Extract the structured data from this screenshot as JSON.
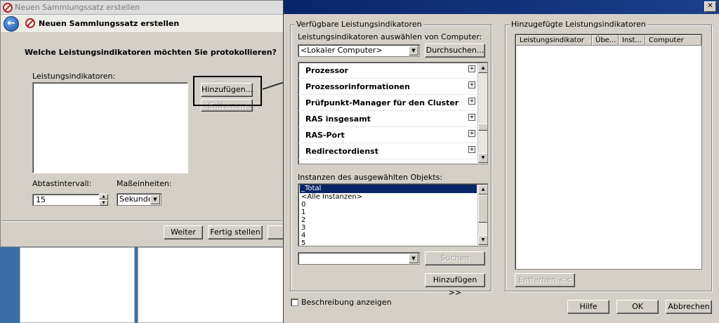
{
  "wizard": {
    "window_title": "Neuen Sammlungssatz erstellen",
    "header_title": "Neuen Sammlungssatz erstellen",
    "question": "Welche Leistungsindikatoren möchten Sie protokollieren?",
    "counters_label": "Leistungsindikatoren:",
    "add_button": "Hinzufügen...",
    "remove_button": "Entfernen",
    "interval_label": "Abtastintervall:",
    "interval_value": "15",
    "units_label": "Maßeinheiten:",
    "units_value": "Sekunden",
    "next_button": "Weiter",
    "finish_button": "Fertig stellen"
  },
  "dialog": {
    "available_group": "Verfügbare Leistungsindikatoren",
    "select_from_label": "Leistungsindikatoren auswählen von Computer:",
    "computer_value": "<Lokaler Computer>",
    "browse_button": "Durchsuchen...",
    "objects": [
      "Prozessor",
      "Prozessorinformationen",
      "Prüfpunkt-Manager für den Cluster",
      "RAS insgesamt",
      "RAS-Port",
      "Redirectordienst"
    ],
    "instances_label": "Instanzen des ausgewählten Objekts:",
    "instances": [
      "_Total",
      "<Alle Instanzen>",
      "0",
      "1",
      "2",
      "3",
      "4",
      "5"
    ],
    "selected_instance": "_Total",
    "search_button": "Suchen",
    "add_button": "Hinzufügen >>",
    "added_group": "Hinzugefügte Leistungsindikatoren",
    "table_headers": [
      "Leistungsindikator",
      "Übe...",
      "Inst...",
      "Computer"
    ],
    "remove_button": "Entfernen <<",
    "show_description_label": "Beschreibung anzeigen",
    "show_description_checked": false,
    "help_button": "Hilfe",
    "ok_button": "OK",
    "cancel_button": "Abbrechen"
  },
  "colors": {
    "desktop": "#3a6ea5",
    "titlebar_active": "#0a246a",
    "selection": "#0a246a",
    "window_face": "#d4d0c8"
  },
  "icons": {
    "back": "back-arrow-icon",
    "app": "no-entry-app-icon",
    "close": "close-icon",
    "expand": "plus-expand-icon",
    "dropdown": "chevron-down-icon"
  }
}
